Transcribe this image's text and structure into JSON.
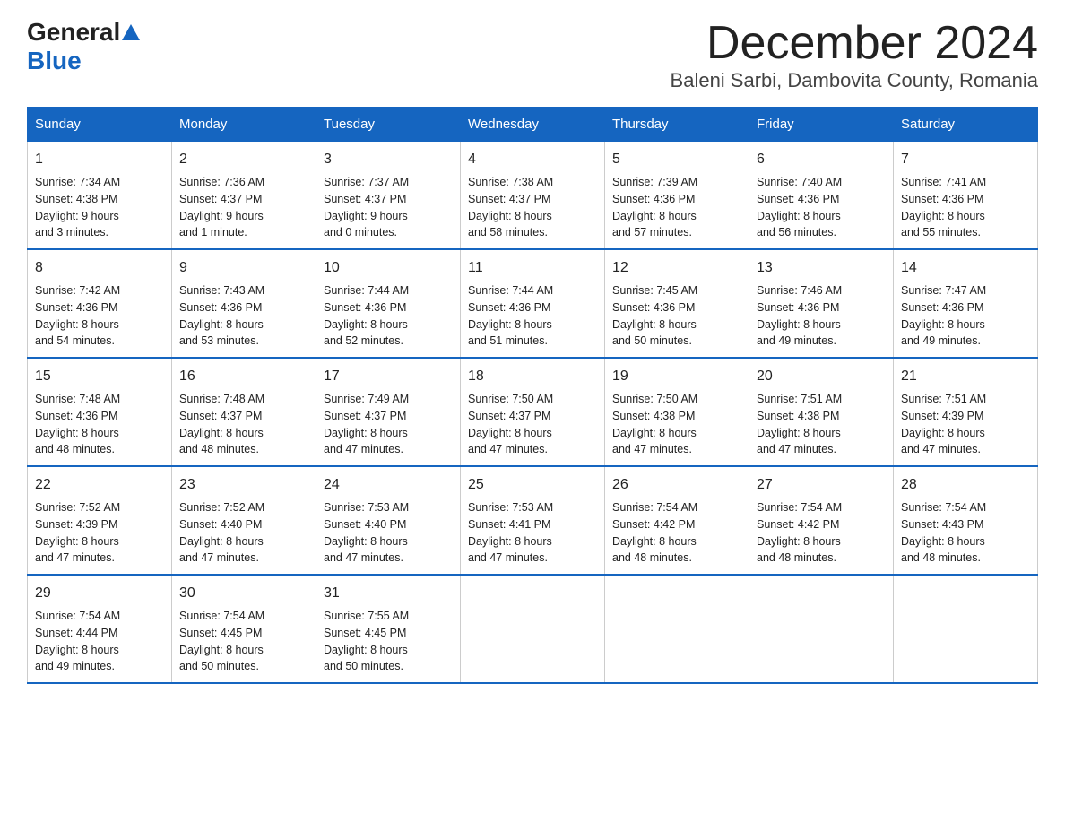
{
  "logo": {
    "general": "General",
    "blue": "Blue"
  },
  "title": "December 2024",
  "location": "Baleni Sarbi, Dambovita County, Romania",
  "days_of_week": [
    "Sunday",
    "Monday",
    "Tuesday",
    "Wednesday",
    "Thursday",
    "Friday",
    "Saturday"
  ],
  "weeks": [
    [
      {
        "day": 1,
        "sunrise": "7:34 AM",
        "sunset": "4:38 PM",
        "daylight": "9 hours and 3 minutes."
      },
      {
        "day": 2,
        "sunrise": "7:36 AM",
        "sunset": "4:37 PM",
        "daylight": "9 hours and 1 minute."
      },
      {
        "day": 3,
        "sunrise": "7:37 AM",
        "sunset": "4:37 PM",
        "daylight": "9 hours and 0 minutes."
      },
      {
        "day": 4,
        "sunrise": "7:38 AM",
        "sunset": "4:37 PM",
        "daylight": "8 hours and 58 minutes."
      },
      {
        "day": 5,
        "sunrise": "7:39 AM",
        "sunset": "4:36 PM",
        "daylight": "8 hours and 57 minutes."
      },
      {
        "day": 6,
        "sunrise": "7:40 AM",
        "sunset": "4:36 PM",
        "daylight": "8 hours and 56 minutes."
      },
      {
        "day": 7,
        "sunrise": "7:41 AM",
        "sunset": "4:36 PM",
        "daylight": "8 hours and 55 minutes."
      }
    ],
    [
      {
        "day": 8,
        "sunrise": "7:42 AM",
        "sunset": "4:36 PM",
        "daylight": "8 hours and 54 minutes."
      },
      {
        "day": 9,
        "sunrise": "7:43 AM",
        "sunset": "4:36 PM",
        "daylight": "8 hours and 53 minutes."
      },
      {
        "day": 10,
        "sunrise": "7:44 AM",
        "sunset": "4:36 PM",
        "daylight": "8 hours and 52 minutes."
      },
      {
        "day": 11,
        "sunrise": "7:44 AM",
        "sunset": "4:36 PM",
        "daylight": "8 hours and 51 minutes."
      },
      {
        "day": 12,
        "sunrise": "7:45 AM",
        "sunset": "4:36 PM",
        "daylight": "8 hours and 50 minutes."
      },
      {
        "day": 13,
        "sunrise": "7:46 AM",
        "sunset": "4:36 PM",
        "daylight": "8 hours and 49 minutes."
      },
      {
        "day": 14,
        "sunrise": "7:47 AM",
        "sunset": "4:36 PM",
        "daylight": "8 hours and 49 minutes."
      }
    ],
    [
      {
        "day": 15,
        "sunrise": "7:48 AM",
        "sunset": "4:36 PM",
        "daylight": "8 hours and 48 minutes."
      },
      {
        "day": 16,
        "sunrise": "7:48 AM",
        "sunset": "4:37 PM",
        "daylight": "8 hours and 48 minutes."
      },
      {
        "day": 17,
        "sunrise": "7:49 AM",
        "sunset": "4:37 PM",
        "daylight": "8 hours and 47 minutes."
      },
      {
        "day": 18,
        "sunrise": "7:50 AM",
        "sunset": "4:37 PM",
        "daylight": "8 hours and 47 minutes."
      },
      {
        "day": 19,
        "sunrise": "7:50 AM",
        "sunset": "4:38 PM",
        "daylight": "8 hours and 47 minutes."
      },
      {
        "day": 20,
        "sunrise": "7:51 AM",
        "sunset": "4:38 PM",
        "daylight": "8 hours and 47 minutes."
      },
      {
        "day": 21,
        "sunrise": "7:51 AM",
        "sunset": "4:39 PM",
        "daylight": "8 hours and 47 minutes."
      }
    ],
    [
      {
        "day": 22,
        "sunrise": "7:52 AM",
        "sunset": "4:39 PM",
        "daylight": "8 hours and 47 minutes."
      },
      {
        "day": 23,
        "sunrise": "7:52 AM",
        "sunset": "4:40 PM",
        "daylight": "8 hours and 47 minutes."
      },
      {
        "day": 24,
        "sunrise": "7:53 AM",
        "sunset": "4:40 PM",
        "daylight": "8 hours and 47 minutes."
      },
      {
        "day": 25,
        "sunrise": "7:53 AM",
        "sunset": "4:41 PM",
        "daylight": "8 hours and 47 minutes."
      },
      {
        "day": 26,
        "sunrise": "7:54 AM",
        "sunset": "4:42 PM",
        "daylight": "8 hours and 48 minutes."
      },
      {
        "day": 27,
        "sunrise": "7:54 AM",
        "sunset": "4:42 PM",
        "daylight": "8 hours and 48 minutes."
      },
      {
        "day": 28,
        "sunrise": "7:54 AM",
        "sunset": "4:43 PM",
        "daylight": "8 hours and 48 minutes."
      }
    ],
    [
      {
        "day": 29,
        "sunrise": "7:54 AM",
        "sunset": "4:44 PM",
        "daylight": "8 hours and 49 minutes."
      },
      {
        "day": 30,
        "sunrise": "7:54 AM",
        "sunset": "4:45 PM",
        "daylight": "8 hours and 50 minutes."
      },
      {
        "day": 31,
        "sunrise": "7:55 AM",
        "sunset": "4:45 PM",
        "daylight": "8 hours and 50 minutes."
      },
      null,
      null,
      null,
      null
    ]
  ],
  "labels": {
    "sunrise": "Sunrise:",
    "sunset": "Sunset:",
    "daylight": "Daylight:"
  }
}
